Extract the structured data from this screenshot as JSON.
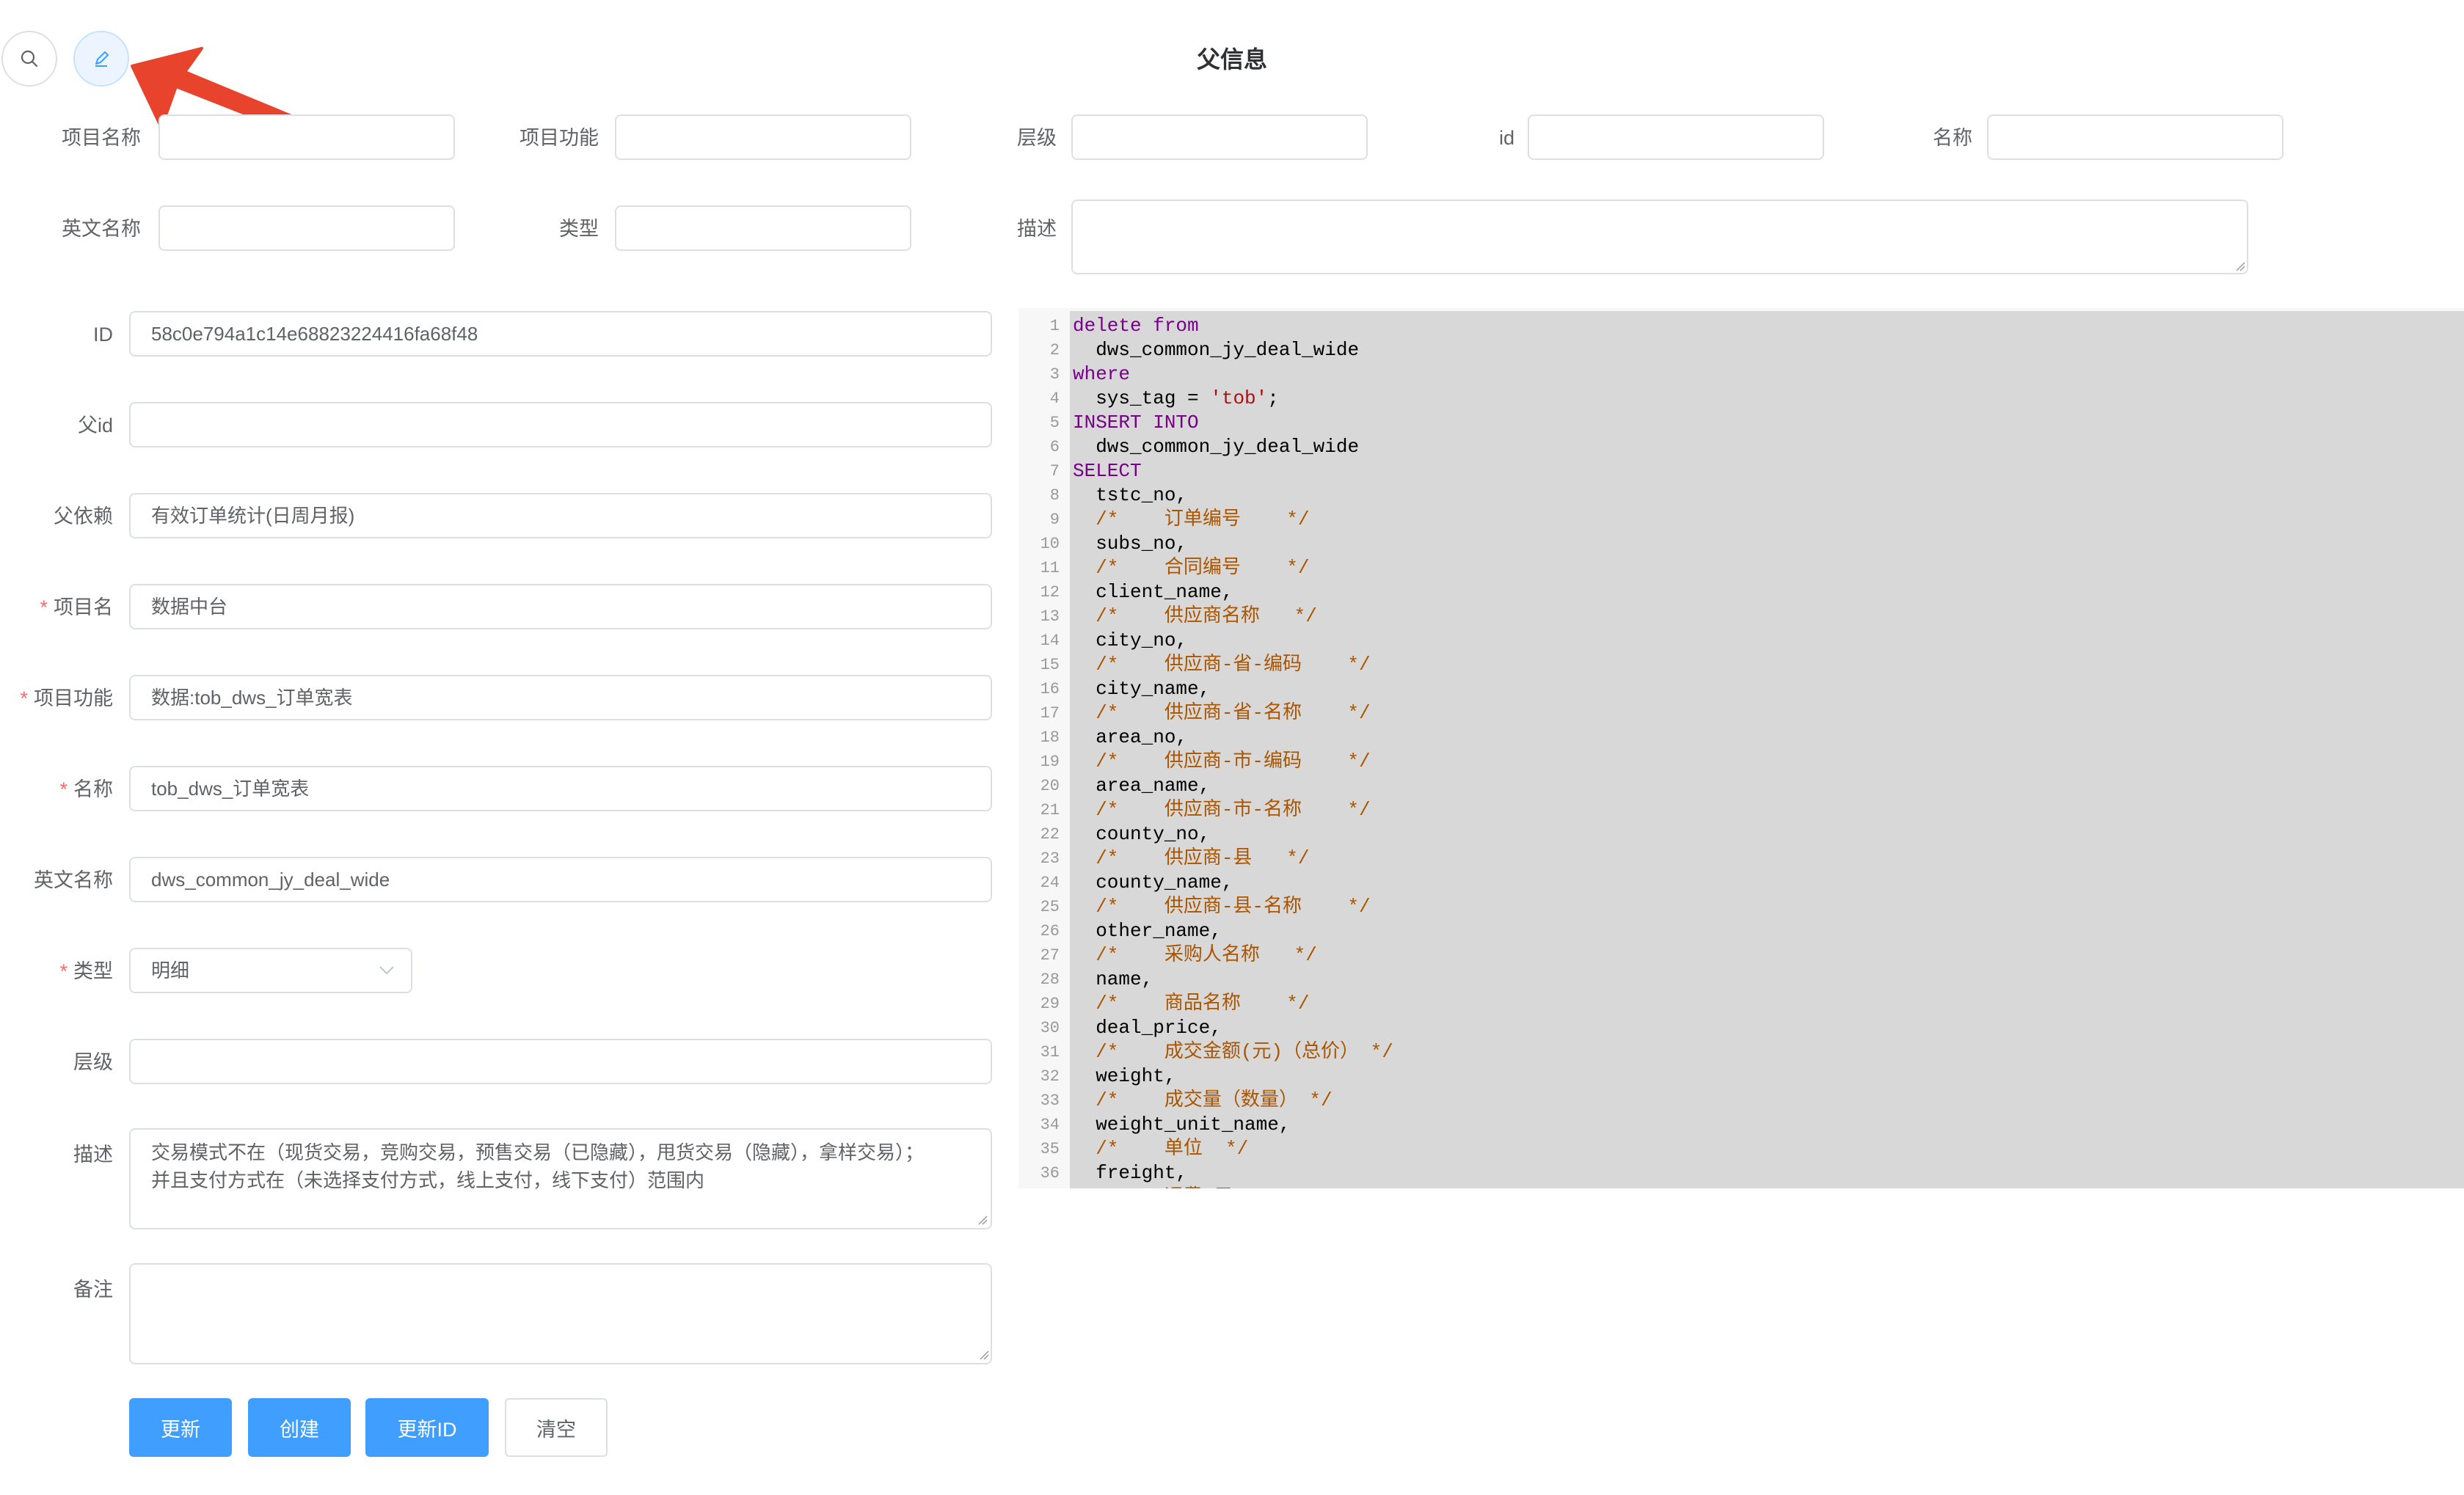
{
  "page": {
    "title": "父信息"
  },
  "toolbar": {
    "search_icon": "search-icon",
    "edit_icon": "edit-icon"
  },
  "annotation": {
    "arrow_color": "#e8432d",
    "arrow_icon": "arrow-pointer-icon"
  },
  "filters": {
    "row1": [
      {
        "label": "项目名称",
        "value": ""
      },
      {
        "label": "项目功能",
        "value": ""
      },
      {
        "label": "层级",
        "value": ""
      },
      {
        "label": "id",
        "value": ""
      },
      {
        "label": "名称",
        "value": ""
      }
    ],
    "row2": [
      {
        "label": "英文名称",
        "value": ""
      },
      {
        "label": "类型",
        "value": ""
      },
      {
        "label": "描述",
        "value": ""
      }
    ]
  },
  "form": {
    "id": {
      "label": "ID",
      "value": "58c0e794a1c14e68823224416fa68f48"
    },
    "parent_id": {
      "label": "父id",
      "value": ""
    },
    "parent_dep": {
      "label": "父依赖",
      "value": "有效订单统计(日周月报)"
    },
    "project_name": {
      "label": "项目名",
      "required": "*",
      "value": "数据中台"
    },
    "project_func": {
      "label": "项目功能",
      "required": "*",
      "value": "数据:tob_dws_订单宽表"
    },
    "name": {
      "label": "名称",
      "required": "*",
      "value": "tob_dws_订单宽表"
    },
    "en_name": {
      "label": "英文名称",
      "value": "dws_common_jy_deal_wide"
    },
    "type": {
      "label": "类型",
      "required": "*",
      "value": "明细"
    },
    "level": {
      "label": "层级",
      "value": ""
    },
    "desc": {
      "label": "描述",
      "line1": "交易模式不在（现货交易，竞购交易，预售交易（已隐藏），甩货交易（隐藏），拿样交易）；",
      "line2": "并且支付方式在（未选择支付方式，线上支付，线下支付）范围内"
    },
    "remark": {
      "label": "备注",
      "value": ""
    }
  },
  "buttons": {
    "update": "更新",
    "create": "创建",
    "update_id": "更新ID",
    "clear": "清空"
  },
  "colors": {
    "primary": "#409eff",
    "required": "#f56c6c",
    "editor_bg": "#d8d8d8"
  },
  "code_lines": [
    [
      [
        "kw",
        "delete from"
      ]
    ],
    [
      [
        "txt",
        "  dws_common_jy_deal_wide"
      ]
    ],
    [
      [
        "kw",
        "where"
      ]
    ],
    [
      [
        "txt",
        "  sys_tag = "
      ],
      [
        "str",
        "'tob'"
      ],
      [
        "txt",
        ";"
      ]
    ],
    [
      [
        "kw",
        "INSERT INTO"
      ]
    ],
    [
      [
        "txt",
        "  dws_common_jy_deal_wide"
      ]
    ],
    [
      [
        "kw",
        "SELECT"
      ]
    ],
    [
      [
        "txt",
        "  tstc_no,"
      ]
    ],
    [
      [
        "cmt",
        "  /*    订单编号    */"
      ]
    ],
    [
      [
        "txt",
        "  subs_no,"
      ]
    ],
    [
      [
        "cmt",
        "  /*    合同编号    */"
      ]
    ],
    [
      [
        "txt",
        "  client_name,"
      ]
    ],
    [
      [
        "cmt",
        "  /*    供应商名称   */"
      ]
    ],
    [
      [
        "txt",
        "  city_no,"
      ]
    ],
    [
      [
        "cmt",
        "  /*    供应商-省-编码    */"
      ]
    ],
    [
      [
        "txt",
        "  city_name,"
      ]
    ],
    [
      [
        "cmt",
        "  /*    供应商-省-名称    */"
      ]
    ],
    [
      [
        "txt",
        "  area_no,"
      ]
    ],
    [
      [
        "cmt",
        "  /*    供应商-市-编码    */"
      ]
    ],
    [
      [
        "txt",
        "  area_name,"
      ]
    ],
    [
      [
        "cmt",
        "  /*    供应商-市-名称    */"
      ]
    ],
    [
      [
        "txt",
        "  county_no,"
      ]
    ],
    [
      [
        "cmt",
        "  /*    供应商-县   */"
      ]
    ],
    [
      [
        "txt",
        "  county_name,"
      ]
    ],
    [
      [
        "cmt",
        "  /*    供应商-县-名称    */"
      ]
    ],
    [
      [
        "txt",
        "  other_name,"
      ]
    ],
    [
      [
        "cmt",
        "  /*    采购人名称   */"
      ]
    ],
    [
      [
        "txt",
        "  name,"
      ]
    ],
    [
      [
        "cmt",
        "  /*    商品名称    */"
      ]
    ],
    [
      [
        "txt",
        "  deal_price,"
      ]
    ],
    [
      [
        "cmt",
        "  /*    成交金额(元)（总价） */"
      ]
    ],
    [
      [
        "txt",
        "  weight,"
      ]
    ],
    [
      [
        "cmt",
        "  /*    成交量（数量） */"
      ]
    ],
    [
      [
        "txt",
        "  weight_unit_name,"
      ]
    ],
    [
      [
        "cmt",
        "  /*    单位  */"
      ]
    ],
    [
      [
        "txt",
        "  freight,"
      ]
    ],
    [
      [
        "cmt",
        "  /*    运费(元)   */"
      ]
    ]
  ]
}
